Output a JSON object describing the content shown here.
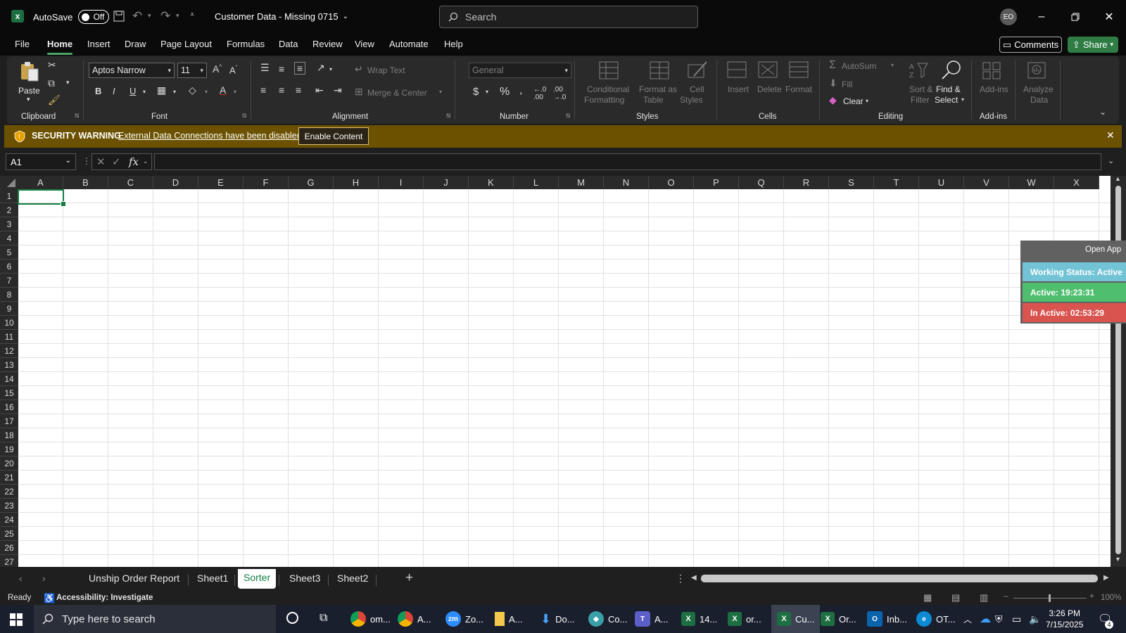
{
  "titlebar": {
    "autosave_label": "AutoSave",
    "autosave_state": "Off",
    "doc_title": "Customer Data - Missing 0715",
    "search_placeholder": "Search",
    "user_initials": "EO"
  },
  "menu": {
    "items": [
      "File",
      "Home",
      "Insert",
      "Draw",
      "Page Layout",
      "Formulas",
      "Data",
      "Review",
      "View",
      "Automate",
      "Help"
    ],
    "active": "Home",
    "comments_label": "Comments",
    "share_label": "Share"
  },
  "ribbon": {
    "clipboard": {
      "paste": "Paste",
      "group": "Clipboard"
    },
    "font": {
      "name": "Aptos Narrow",
      "size": "11",
      "group": "Font"
    },
    "alignment": {
      "wrap_text": "Wrap Text",
      "merge_center": "Merge & Center",
      "group": "Alignment"
    },
    "number": {
      "format": "General",
      "group": "Number"
    },
    "styles": {
      "conditional_l1": "Conditional",
      "conditional_l2": "Formatting",
      "table_l1": "Format as",
      "table_l2": "Table",
      "cell_l1": "Cell",
      "cell_l2": "Styles",
      "group": "Styles"
    },
    "cells": {
      "insert": "Insert",
      "delete": "Delete",
      "format": "Format",
      "group": "Cells"
    },
    "editing": {
      "autosum": "AutoSum",
      "fill": "Fill",
      "clear": "Clear",
      "sort_l1": "Sort &",
      "sort_l2": "Filter",
      "find_l1": "Find &",
      "find_l2": "Select",
      "group": "Editing"
    },
    "addins": {
      "addins_l1": "Add-ins",
      "analyze_l1": "Analyze",
      "analyze_l2": "Data",
      "group": "Add-ins"
    }
  },
  "security": {
    "title": "SECURITY WARNING",
    "message": "External Data Connections have been disabled",
    "button": "Enable Content"
  },
  "formula": {
    "namebox": "A1",
    "fx": "fx"
  },
  "grid": {
    "columns": [
      "A",
      "B",
      "C",
      "D",
      "E",
      "F",
      "G",
      "H",
      "I",
      "J",
      "K",
      "L",
      "M",
      "N",
      "O",
      "P",
      "Q",
      "R",
      "S",
      "T",
      "U",
      "V",
      "W",
      "X"
    ],
    "rows": [
      "1",
      "2",
      "3",
      "4",
      "5",
      "6",
      "7",
      "8",
      "9",
      "10",
      "11",
      "12",
      "13",
      "14",
      "15",
      "16",
      "17",
      "18",
      "19",
      "20",
      "21",
      "22",
      "23",
      "24",
      "25",
      "26",
      "27"
    ]
  },
  "widget": {
    "open_app": "Open App",
    "working_status": "Working Status: Active",
    "active_time": "Active: 19:23:31",
    "inactive_time": "In Active: 02:53:29",
    "colors": {
      "working": "#72c3d6",
      "active": "#4fbf6f",
      "inactive": "#d9534f"
    }
  },
  "sheets": {
    "tabs": [
      "Unship Order Report",
      "Sheet1",
      "Sorter",
      "Sheet3",
      "Sheet2"
    ],
    "active": "Sorter"
  },
  "status": {
    "ready": "Ready",
    "accessibility": "Accessibility: Investigate",
    "zoom": "100%"
  },
  "taskbar": {
    "search_placeholder": "Type here to search",
    "apps": [
      "om...",
      "A...",
      "Zo...",
      "A...",
      "Do...",
      "Co...",
      "A...",
      "14...",
      "or...",
      "Cu...",
      "Or...",
      "Inb...",
      "OT..."
    ],
    "time": "3:26 PM",
    "date": "7/15/2025",
    "notifications": "4"
  },
  "colors": {
    "excel_green": "#137e43",
    "share_green": "#2f7d45",
    "warning_bar": "#6b5100"
  }
}
